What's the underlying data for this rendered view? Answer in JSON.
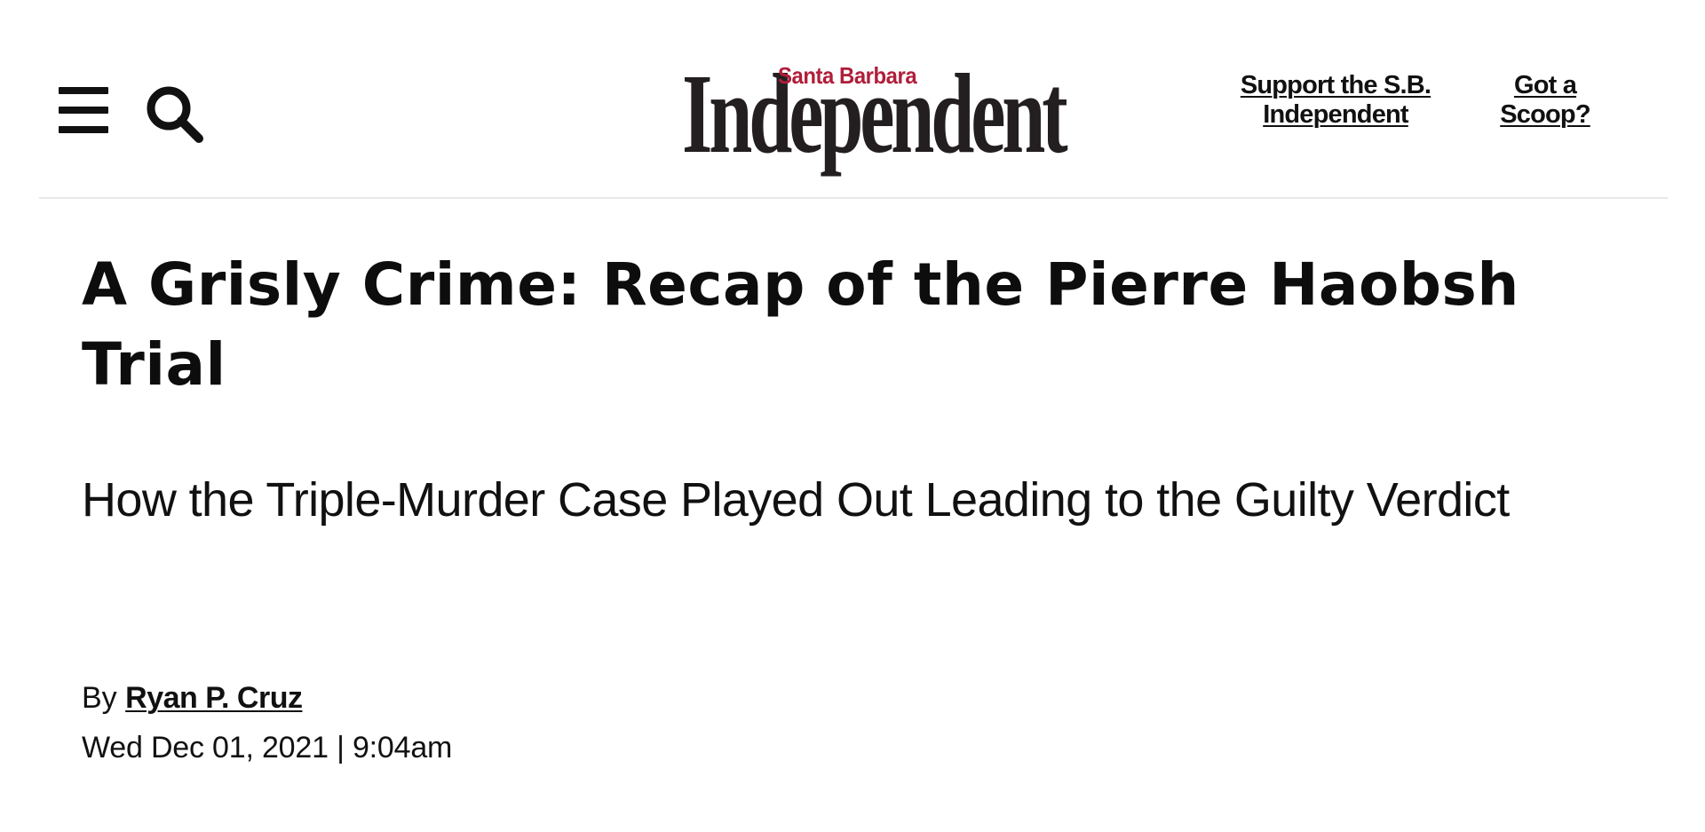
{
  "header": {
    "menu_icon": "hamburger-menu-icon",
    "search_icon": "search-icon",
    "logo": {
      "top_text": "Santa Barbara",
      "main_text": "Independent",
      "top_color": "#b01e3a",
      "main_color": "#231f20"
    },
    "links": {
      "support": "Support the S.B. Independent",
      "scoop": "Got a Scoop?"
    }
  },
  "article": {
    "title": "A Grisly Crime: Recap of the Pierre Haobsh Trial",
    "subtitle": "How the Triple-Murder Case Played Out Leading to the Guilty Verdict",
    "byline_prefix": "By",
    "author": "Ryan P. Cruz",
    "date": "Wed Dec 01, 2021",
    "separator": "|",
    "time": "9:04am"
  }
}
